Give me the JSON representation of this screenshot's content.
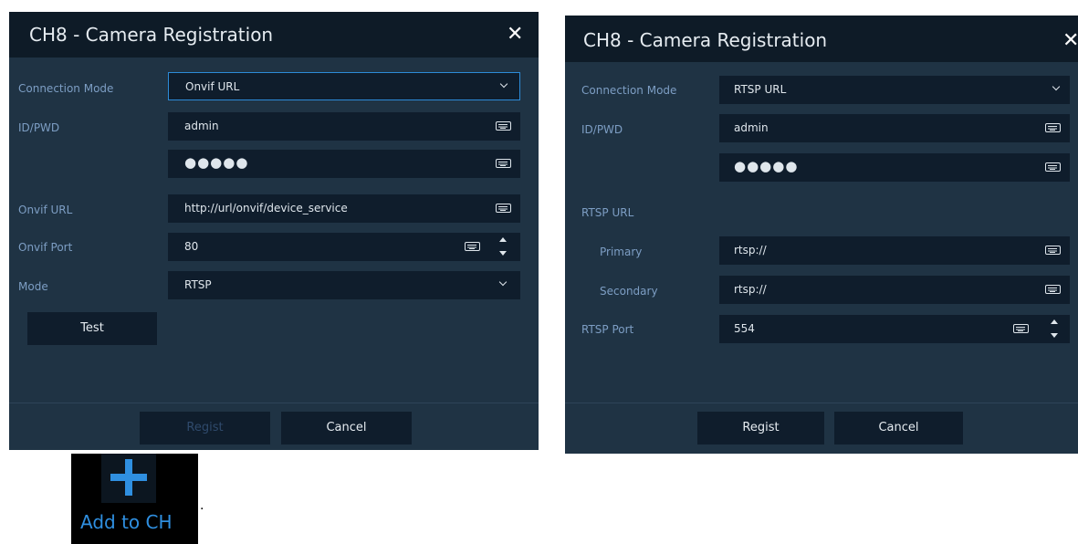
{
  "dialog_left": {
    "title": "CH8 - Camera Registration",
    "close_label": "✕",
    "labels": {
      "connection_mode": "Connection Mode",
      "id_pwd": "ID/PWD",
      "onvif_url": "Onvif URL",
      "onvif_port": "Onvif Port",
      "mode": "Mode"
    },
    "fields": {
      "connection_mode": "Onvif URL",
      "id": "admin",
      "password": "●●●●●",
      "onvif_url": "http://url/onvif/device_service",
      "onvif_port": "80",
      "mode": "RTSP"
    },
    "buttons": {
      "test": "Test",
      "regist": "Regist",
      "cancel": "Cancel"
    }
  },
  "dialog_right": {
    "title": "CH8 - Camera Registration",
    "close_label": "✕",
    "labels": {
      "connection_mode": "Connection Mode",
      "id_pwd": "ID/PWD",
      "rtsp_url": "RTSP URL",
      "primary": "Primary",
      "secondary": "Secondary",
      "rtsp_port": "RTSP Port"
    },
    "fields": {
      "connection_mode": "RTSP URL",
      "id": "admin",
      "password": "●●●●●",
      "primary": "rtsp://",
      "secondary": "rtsp://",
      "rtsp_port": "554"
    },
    "buttons": {
      "regist": "Regist",
      "cancel": "Cancel"
    }
  },
  "add_to_ch": {
    "label": "Add to CH",
    "icon": "plus-icon"
  },
  "trailing_text": ".",
  "colors": {
    "dialog_bg": "#1f3344",
    "header_bg": "#0e1b27",
    "field_bg": "#0f1d2c",
    "label": "#7d9ec4",
    "accent": "#2f8fe0",
    "focus_border": "#2c8bd8"
  }
}
